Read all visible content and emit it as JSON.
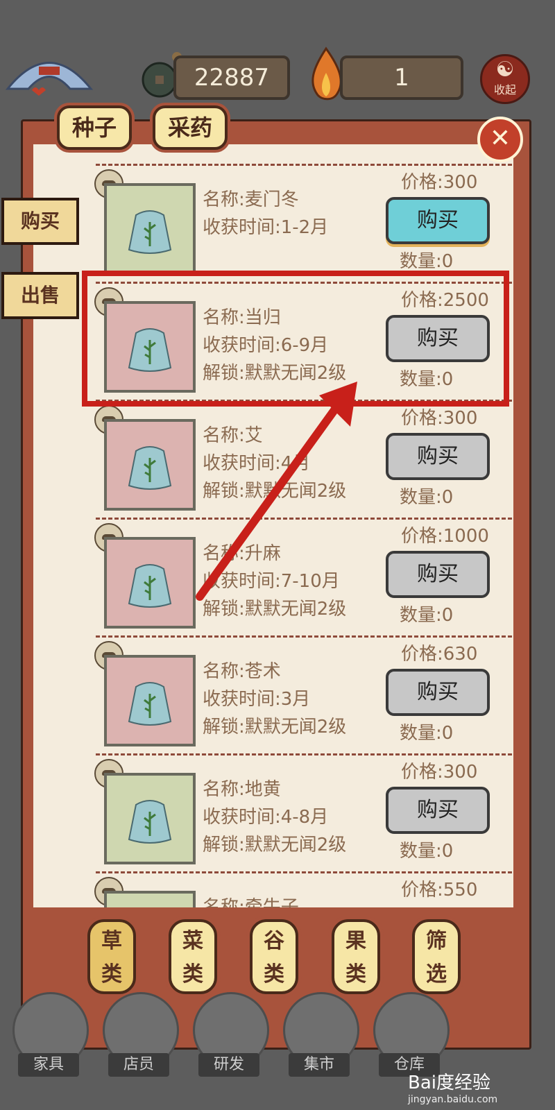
{
  "topbar": {
    "coins": "22887",
    "fire": "1",
    "collapse_label": "收起",
    "collapse_symbol": "☯"
  },
  "tabs": {
    "seed": "种子",
    "herb": "采药"
  },
  "close_symbol": "✕",
  "side": {
    "buy": "购买",
    "sell": "出售"
  },
  "items": [
    {
      "name": "名称:麦门冬",
      "time": "收获时间:1-2月",
      "unlock": "",
      "price": "价格:300",
      "button": "购买",
      "qty": "数量:0"
    },
    {
      "name": "名称:当归",
      "time": "收获时间:6-9月",
      "unlock": "解锁:默默无闻2级",
      "price": "价格:2500",
      "button": "购买",
      "qty": "数量:0"
    },
    {
      "name": "名称:艾",
      "time": "收获时间:4月",
      "unlock": "解锁:默默无闻2级",
      "price": "价格:300",
      "button": "购买",
      "qty": "数量:0"
    },
    {
      "name": "名称:升麻",
      "time": "收获时间:7-10月",
      "unlock": "解锁:默默无闻2级",
      "price": "价格:1000",
      "button": "购买",
      "qty": "数量:0"
    },
    {
      "name": "名称:苍术",
      "time": "收获时间:3月",
      "unlock": "解锁:默默无闻2级",
      "price": "价格:630",
      "button": "购买",
      "qty": "数量:0"
    },
    {
      "name": "名称:地黄",
      "time": "收获时间:4-8月",
      "unlock": "解锁:默默无闻2级",
      "price": "价格:300",
      "button": "购买",
      "qty": "数量:0"
    },
    {
      "name": "名称:牵牛子",
      "time": "",
      "unlock": "",
      "price": "价格:550",
      "button": "",
      "qty": ""
    }
  ],
  "categories": [
    {
      "top": "草",
      "bottom": "类"
    },
    {
      "top": "菜",
      "bottom": "类"
    },
    {
      "top": "谷",
      "bottom": "类"
    },
    {
      "top": "果",
      "bottom": "类"
    },
    {
      "top": "筛",
      "bottom": "选"
    }
  ],
  "nav": [
    "家具",
    "店员",
    "研发",
    "集市",
    "仓库"
  ],
  "watermark": {
    "brand": "Bai度经验",
    "url": "jingyan.baidu.com"
  },
  "colors": {
    "highlight": "#c8201a",
    "active_button": "#6fcfd7",
    "frame": "#a8533c"
  }
}
